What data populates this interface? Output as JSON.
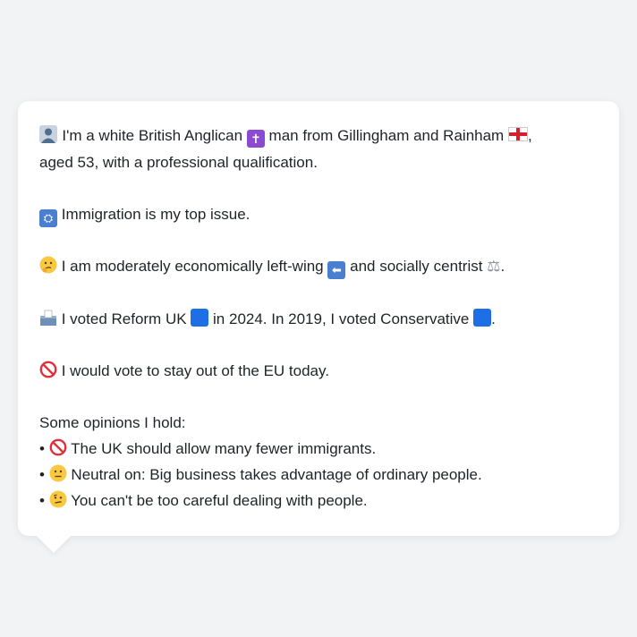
{
  "profile": {
    "intro_line1_a": "I'm a white British Anglican",
    "intro_line1_b": "man from Gillingham and Rainham",
    "intro_line2": "aged 53, with a professional qualification.",
    "top_issue": "Immigration is my top issue.",
    "ideology_a": "I am moderately economically left-wing",
    "ideology_b": "and socially centrist",
    "vote_a": "I voted Reform UK",
    "vote_b": "in 2024. In 2019, I voted Conservative",
    "eu": "I would vote to stay out of the EU today.",
    "opinions_heading": "Some opinions I hold:",
    "opinions": [
      "The UK should allow many fewer immigrants.",
      "Neutral on: Big business takes advantage of ordinary people.",
      "You can't be too careful dealing with people."
    ]
  },
  "icons": {
    "person": "person-silhouette-icon",
    "cross": "latin-cross-icon",
    "flag": "england-flag-icon",
    "passport": "passport-control-icon",
    "thinking": "thinking-face-icon",
    "left_arrow": "left-arrow-icon",
    "scales": "balance-scale-icon",
    "ballot": "ballot-box-icon",
    "blue_square": "blue-square-icon",
    "no_entry": "prohibited-icon",
    "neutral": "neutral-face-icon",
    "skeptical": "raised-eyebrow-face-icon"
  },
  "colors": {
    "background": "#f2f3f5",
    "card": "#ffffff",
    "text": "#1f2328",
    "reform_blue": "#1e6fe6",
    "conservative_blue": "#1e6fe6"
  }
}
